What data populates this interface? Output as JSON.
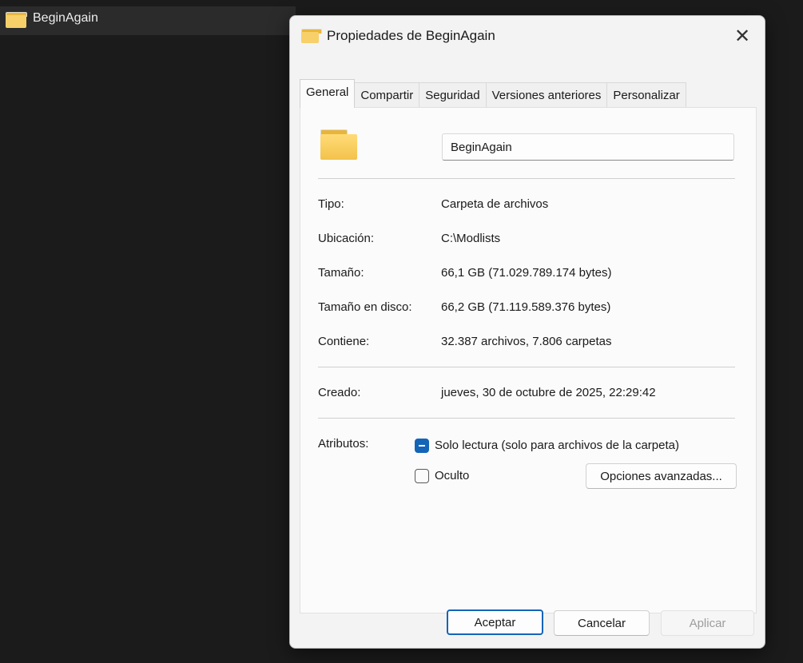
{
  "explorer": {
    "item_name": "BeginAgain"
  },
  "dialog": {
    "title": "Propiedades de BeginAgain",
    "close_symbol": "✕",
    "tabs": [
      {
        "label": "General",
        "active": true
      },
      {
        "label": "Compartir"
      },
      {
        "label": "Seguridad"
      },
      {
        "label": "Versiones anteriores"
      },
      {
        "label": "Personalizar"
      }
    ],
    "name_value": "BeginAgain",
    "props": [
      {
        "label": "Tipo:",
        "value": "Carpeta de archivos"
      },
      {
        "label": "Ubicación:",
        "value": "C:\\Modlists"
      },
      {
        "label": "Tamaño:",
        "value": "66,1 GB (71.029.789.174 bytes)"
      },
      {
        "label": "Tamaño en disco:",
        "value": "66,2 GB (71.119.589.376 bytes)"
      },
      {
        "label": "Contiene:",
        "value": "32.387 archivos, 7.806 carpetas"
      }
    ],
    "created": {
      "label": "Creado:",
      "value": "jueves, 30 de octubre de 2025, 22:29:42"
    },
    "attributes": {
      "label": "Atributos:",
      "readonly": {
        "label": "Solo lectura (solo para archivos de la carpeta)",
        "state": "indeterminate"
      },
      "hidden": {
        "label": "Oculto",
        "state": "unchecked"
      },
      "advanced_button": "Opciones avanzadas..."
    },
    "buttons": {
      "ok": "Aceptar",
      "cancel": "Cancelar",
      "apply": "Aplicar"
    },
    "accent_color": "#1464b8"
  }
}
